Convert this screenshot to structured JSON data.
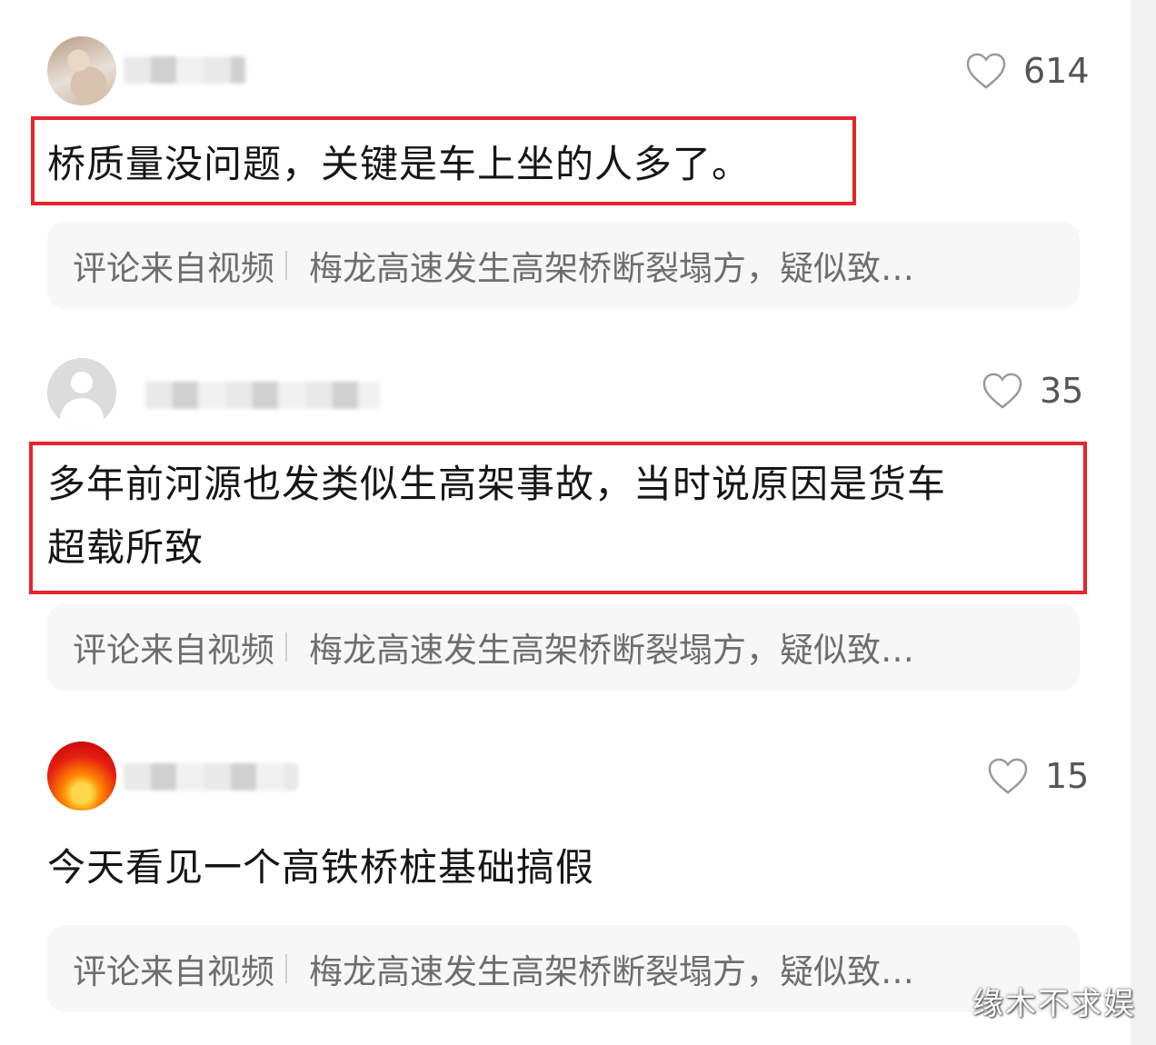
{
  "comments": [
    {
      "likes": "614",
      "text": "桥质量没问题，关键是车上坐的人多了。",
      "source_label": "评论来自视频",
      "source_title": "梅龙高速发生高架桥断裂塌方，疑似致…"
    },
    {
      "likes": "35",
      "text_line1": "多年前河源也发类似生高架事故，当时说原因是货车",
      "text_line2": "超载所致",
      "source_label": "评论来自视频",
      "source_title": "梅龙高速发生高架桥断裂塌方，疑似致…"
    },
    {
      "likes": "15",
      "text": "今天看见一个高铁桥桩基础搞假",
      "source_label": "评论来自视频",
      "source_title": "梅龙高速发生高架桥断裂塌方，疑似致…"
    }
  ],
  "watermark": "缘木不求娱",
  "colors": {
    "highlight": "#e8242c",
    "like_icon": "#9a9a9a"
  },
  "icons": [
    "heart-icon",
    "default-avatar-icon"
  ]
}
